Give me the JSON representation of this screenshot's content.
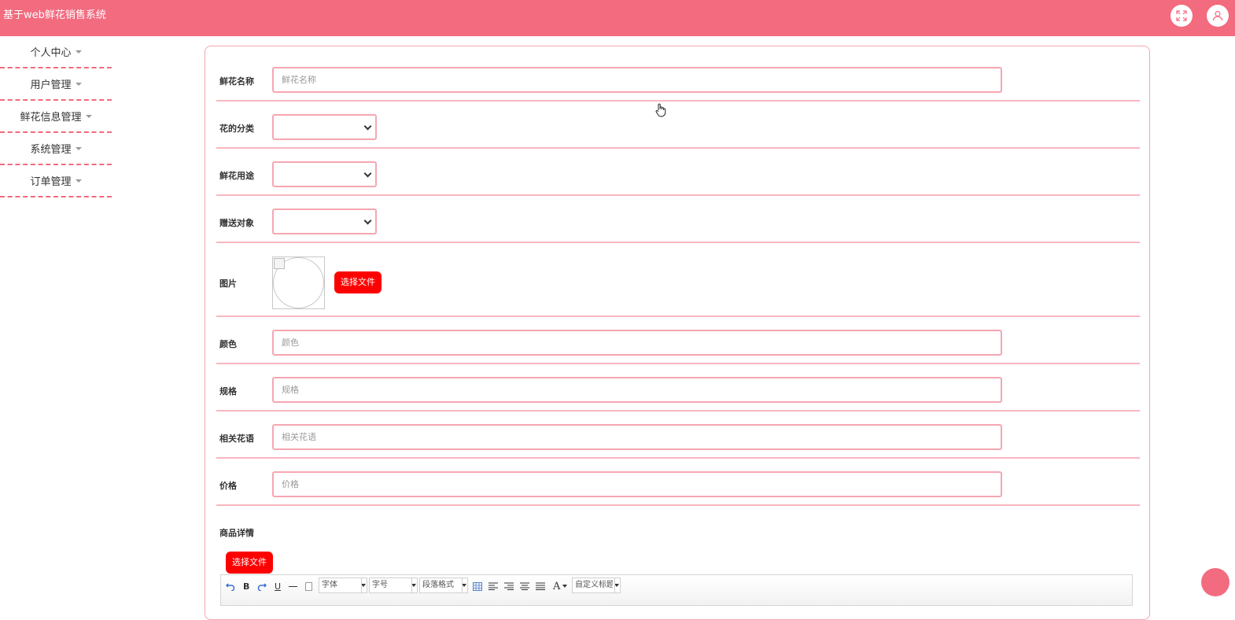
{
  "header": {
    "title": "基于web鲜花销售系统",
    "fullscreen_icon": "fullscreen-icon",
    "user_icon": "user-icon",
    "accent_color": "#f26b7f"
  },
  "sidebar": {
    "items": [
      {
        "label": "个人中心"
      },
      {
        "label": "用户管理"
      },
      {
        "label": "鲜花信息管理"
      },
      {
        "label": "系统管理"
      },
      {
        "label": "订单管理"
      }
    ]
  },
  "form": {
    "name": {
      "label": "鲜花名称",
      "placeholder": "鲜花名称"
    },
    "category": {
      "label": "花的分类",
      "value": ""
    },
    "usage": {
      "label": "鲜花用途",
      "value": ""
    },
    "recipient": {
      "label": "赠送对象",
      "value": ""
    },
    "image": {
      "label": "图片",
      "button": "选择文件"
    },
    "color": {
      "label": "颜色",
      "placeholder": "颜色"
    },
    "spec": {
      "label": "规格",
      "placeholder": "规格"
    },
    "language": {
      "label": "相关花语",
      "placeholder": "相关花语"
    },
    "price": {
      "label": "价格",
      "placeholder": "价格"
    },
    "details": {
      "label": "商品详情",
      "button": "选择文件"
    }
  },
  "editor_toolbar": {
    "bold": "B",
    "underline": "U",
    "font_family": "字体",
    "font_size": "字号",
    "paragraph": "段落格式",
    "font_color": "A",
    "custom_title": "自定义标题"
  }
}
